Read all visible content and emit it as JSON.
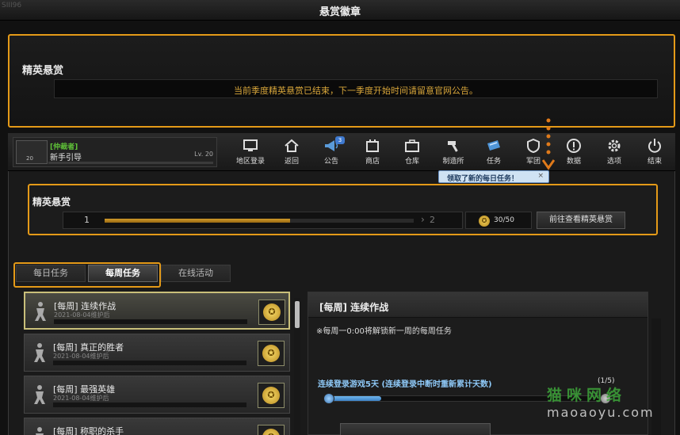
{
  "window": {
    "title": "悬赏徽章",
    "corner_text": "SIII96"
  },
  "notice": {
    "heading": "精英悬赏",
    "message": "当前季度精英悬赏已结束，下一季度开始时间请留意官网公告。"
  },
  "player": {
    "rank": "[仲裁者]",
    "name": "新手引导",
    "level": "Lv. 20",
    "avatar_level": "20"
  },
  "nav": {
    "items": [
      {
        "label": "地区登录",
        "icon": "monitor-icon"
      },
      {
        "label": "返回",
        "icon": "home-icon"
      },
      {
        "label": "公告",
        "icon": "megaphone-icon",
        "badge": "3"
      },
      {
        "label": "商店",
        "icon": "shop-icon"
      },
      {
        "label": "仓库",
        "icon": "briefcase-icon"
      },
      {
        "label": "制造所",
        "icon": "hammer-icon"
      },
      {
        "label": "任务",
        "icon": "ticket-icon"
      },
      {
        "label": "军团",
        "icon": "shield-icon"
      },
      {
        "label": "数据",
        "icon": "info-icon"
      },
      {
        "label": "选项",
        "icon": "gear-icon"
      },
      {
        "label": "结束",
        "icon": "power-icon"
      }
    ]
  },
  "tooltip": {
    "text": "领取了新的每日任务！",
    "close": "×"
  },
  "elite": {
    "title": "精英悬赏",
    "level_from": "1",
    "level_to": "2",
    "progress": 0.6,
    "coins": "30/50",
    "button": "前往查看精英悬赏"
  },
  "tabs": [
    "每日任务",
    "每周任务",
    "在线活动"
  ],
  "quests": [
    {
      "title": "[每周] 连续作战",
      "date": "2021-08-04维护后"
    },
    {
      "title": "[每周] 真正的胜者",
      "date": "2021-08-04维护后"
    },
    {
      "title": "[每周] 最强英雄",
      "date": "2021-08-04维护后"
    },
    {
      "title": "[每周] 称职的杀手",
      "date": ""
    }
  ],
  "detail": {
    "title": "[每周] 连续作战",
    "unlock_note": "※每周一0:00将解锁新一周的每周任务",
    "task": "连续登录游戏5天 (连续登录中断时重新累计天数)",
    "progress_text": "(1/5)",
    "progress": 0.2
  },
  "watermark": {
    "line1": "猫咪网络",
    "line2": "maoaoyu.com"
  },
  "colors": {
    "accent_orange": "#e49a18",
    "rank_green": "#5fc238",
    "task_blue": "#8ec8f6"
  }
}
